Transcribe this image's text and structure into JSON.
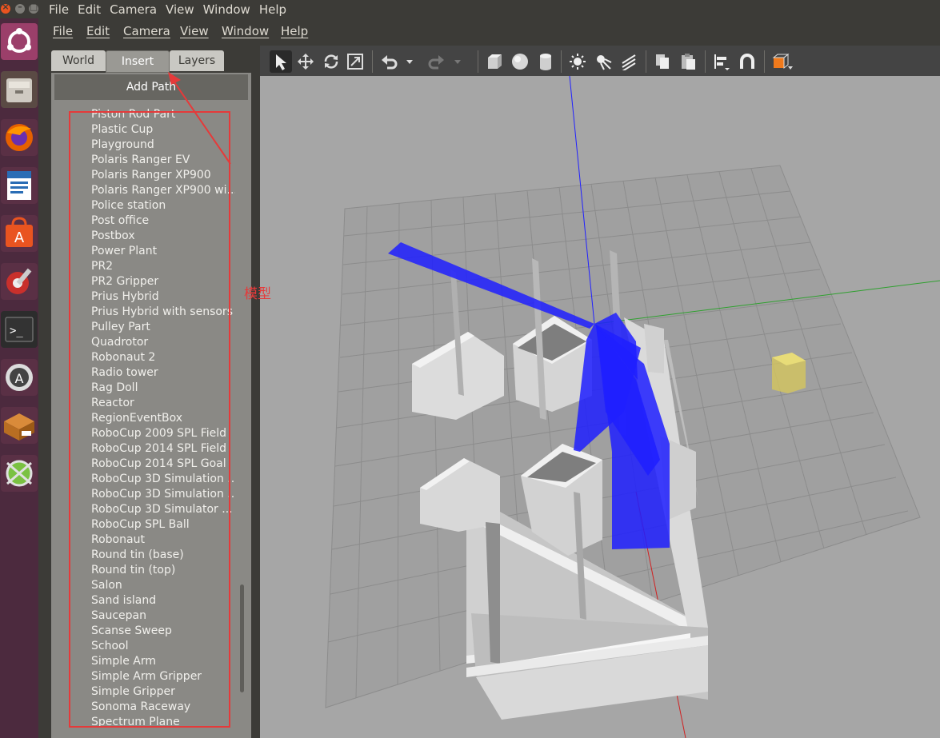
{
  "system_menu": [
    "File",
    "Edit",
    "Camera",
    "View",
    "Window",
    "Help"
  ],
  "window_buttons": {
    "close": "×",
    "minimize": "–",
    "maximize": "□"
  },
  "launcher": {
    "icons": [
      "ubuntu-logo-icon",
      "file-manager-icon",
      "firefox-icon",
      "writer-document-icon",
      "software-center-icon",
      "system-settings-icon",
      "terminal-icon",
      "software-updater-icon",
      "box-package-icon",
      "gazebo-icon"
    ]
  },
  "app_menu": [
    "File",
    "Edit",
    "Camera",
    "View",
    "Window",
    "Help"
  ],
  "tabs": {
    "world": "World",
    "insert": "Insert",
    "layers": "Layers"
  },
  "add_path_label": "Add Path",
  "model_list": [
    "Piston Rod Part",
    "Plastic Cup",
    "Playground",
    "Polaris Ranger EV",
    "Polaris Ranger XP900",
    "Polaris Ranger XP900 wi...",
    "Police station",
    "Post office",
    "Postbox",
    "Power Plant",
    "PR2",
    "PR2 Gripper",
    "Prius Hybrid",
    "Prius Hybrid with sensors",
    "Pulley Part",
    "Quadrotor",
    "Robonaut 2",
    "Radio tower",
    "Rag Doll",
    "Reactor",
    "RegionEventBox",
    "RoboCup 2009 SPL Field",
    "RoboCup 2014 SPL Field",
    "RoboCup 2014 SPL Goal",
    "RoboCup 3D Simulation ...",
    "RoboCup 3D Simulation ...",
    "RoboCup 3D Simulator ...",
    "RoboCup SPL Ball",
    "Robonaut",
    "Round tin (base)",
    "Round tin (top)",
    "Salon",
    "Sand island",
    "Saucepan",
    "Scanse Sweep",
    "School",
    "Simple Arm",
    "Simple Arm Gripper",
    "Simple Gripper",
    "Sonoma Raceway",
    "Spectrum Plane"
  ],
  "annotation_text": "模型",
  "toolbar_icons": [
    "select-arrow-icon",
    "translate-icon",
    "rotate-icon",
    "scale-icon",
    "undo-icon",
    "undo-dropdown-icon",
    "redo-icon",
    "redo-dropdown-icon",
    "box-shape-icon",
    "sphere-shape-icon",
    "cylinder-shape-icon",
    "point-light-icon",
    "spot-light-icon",
    "directional-light-icon",
    "copy-icon",
    "paste-icon",
    "align-icon",
    "snap-magnet-icon",
    "view-angle-icon"
  ],
  "colors": {
    "accent": "#e95420",
    "laser": "#1f1fff",
    "annotation": "#e53a3a",
    "viewport_bg": "#a6a6a6"
  }
}
